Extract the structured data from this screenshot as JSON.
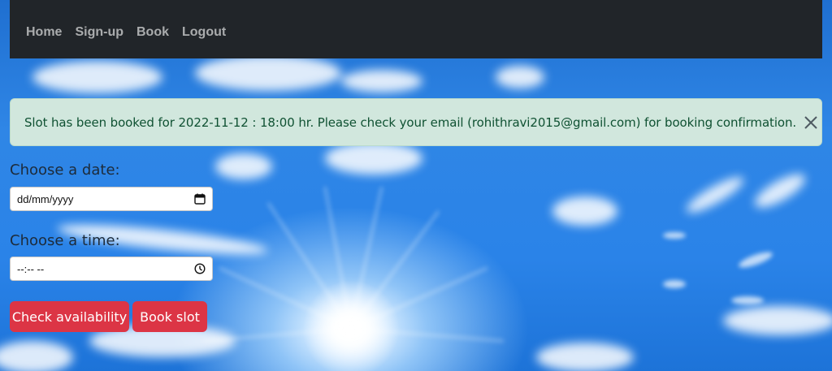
{
  "nav": {
    "items": [
      {
        "label": "Home"
      },
      {
        "label": "Sign-up"
      },
      {
        "label": "Book"
      },
      {
        "label": "Logout"
      }
    ]
  },
  "alert": {
    "message": "Slot has been booked for 2022-11-12 : 18:00 hr. Please check your email (rohithravi2015@gmail.com) for booking confirmation.",
    "close_icon": "close-icon"
  },
  "form": {
    "date_label": "Choose a date:",
    "date_placeholder": "dd/mm/yyyy",
    "date_icon": "calendar-icon",
    "time_label": "Choose a time:",
    "time_placeholder": "--:-- --",
    "time_icon": "clock-icon"
  },
  "buttons": {
    "check_label": "Check availability",
    "book_label": "Book slot"
  },
  "colors": {
    "navbar": "#212529",
    "alert_bg": "#d1e7dd",
    "alert_text": "#0f5132",
    "button": "#dc3545"
  }
}
